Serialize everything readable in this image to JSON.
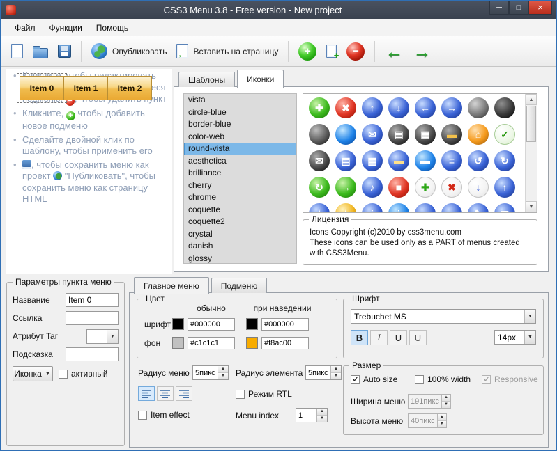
{
  "window": {
    "title": "CSS3 Menu 3.8 - Free version - New project",
    "controls": {
      "minimize": "─",
      "maximize": "□",
      "close": "×"
    }
  },
  "menubar": {
    "items": [
      {
        "label": "Файл"
      },
      {
        "label": "Функции"
      },
      {
        "label": "Помощь"
      }
    ]
  },
  "toolbar": {
    "publish_label": "Опубликовать",
    "insert_label": "Вставить на страницу",
    "plus_glyph": "+",
    "minus_glyph": "−",
    "arrow_left_glyph": "←",
    "arrow_right_glyph": "→"
  },
  "preview": {
    "items": [
      "Item 0",
      "Item 1",
      "Item 2"
    ]
  },
  "instructions": {
    "bullet1_pre": "Кликните, чтобы редактировать параметры пункта и появившееся подменю, ",
    "bullet1_post": ", чтобы удалить пункт",
    "bullet2_pre": "Кликните, ",
    "bullet2_post": " чтобы добавить новое подменю",
    "bullet3": "Сделайте двойной клик по шаблону, чтобы применить его",
    "bullet4_mid": ", чтобы сохранить меню как проект ",
    "bullet4_post": " \"Публиковать\", чтобы сохранить меню как страницу HTML"
  },
  "top_tabs": {
    "templates_label": "Шаблоны",
    "icons_label": "Иконки"
  },
  "templates": {
    "items": [
      "vista",
      "circle-blue",
      "border-blue",
      "color-web",
      "round-vista",
      "aesthetica",
      "brilliance",
      "cherry",
      "chrome",
      "coquette",
      "coquette2",
      "crystal",
      "danish",
      "glossy"
    ],
    "selected": "round-vista"
  },
  "icons": {
    "palettes": {
      "blue": [
        "#c8dcff",
        "#3a63d6",
        "#162e7c"
      ],
      "dark": [
        "#ababab",
        "#4a4a4a",
        "#050505"
      ],
      "green": [
        "#c8f2a8",
        "#3dbb1e",
        "#156d04"
      ],
      "red": [
        "#ffb4a8",
        "#e03524",
        "#8c0e00"
      ],
      "gray1": [
        "#d4d4d4",
        "#7a7a7a",
        "#2a2a2a"
      ],
      "gray2": [
        "#8f8f8f",
        "#383838",
        "#000000"
      ],
      "gray3": [
        "#bdbdbd",
        "#5c5c5c",
        "#101010"
      ],
      "skyblue": [
        "#c2e6ff",
        "#1f83e8",
        "#083e8c"
      ],
      "orange": [
        "#ffe0b0",
        "#f59a1c",
        "#94560a"
      ],
      "check": [
        "#ffffff",
        "#eef8e8",
        "#d8eec8"
      ],
      "light": [
        "#ffffff",
        "#f4f4f4",
        "#e0e0e0"
      ],
      "gold": [
        "#fff2bc",
        "#f0b41e",
        "#8f6400"
      ]
    },
    "grid": [
      {
        "name": "icon-add-circle",
        "glyph": "✚",
        "palette": "green"
      },
      {
        "name": "icon-delete-circle",
        "glyph": "✖",
        "palette": "red"
      },
      {
        "name": "icon-arrow-up-circle",
        "glyph": "↑",
        "palette": "blue"
      },
      {
        "name": "icon-arrow-down-circle",
        "glyph": "↓",
        "palette": "blue"
      },
      {
        "name": "icon-arrow-left-circle",
        "glyph": "←",
        "palette": "blue"
      },
      {
        "name": "icon-arrow-right-circle",
        "glyph": "→",
        "palette": "blue"
      },
      {
        "name": "icon-sphere-gray",
        "glyph": "",
        "palette": "gray1"
      },
      {
        "name": "icon-sphere-black",
        "glyph": "",
        "palette": "gray2"
      },
      {
        "name": "icon-sphere-dark",
        "glyph": "",
        "palette": "gray3"
      },
      {
        "name": "icon-sphere-blue",
        "glyph": "",
        "palette": "skyblue"
      },
      {
        "name": "icon-mail-blue-circle",
        "glyph": "✉",
        "palette": "blue"
      },
      {
        "name": "icon-print-dark-circle",
        "glyph": "▤",
        "palette": "dark"
      },
      {
        "name": "icon-save-dark-circle",
        "glyph": "▦",
        "palette": "dark"
      },
      {
        "name": "icon-folder-dark-circle",
        "glyph": "▬",
        "palette": "dark",
        "fg": "#f3c14b"
      },
      {
        "name": "icon-home-orange-circle",
        "glyph": "⌂",
        "palette": "orange"
      },
      {
        "name": "icon-check-circle",
        "glyph": "✓",
        "palette": "check",
        "fg": "#2a9a12",
        "border": "#a8cc98"
      },
      {
        "name": "icon-mail-dark-circle",
        "glyph": "✉",
        "palette": "dark"
      },
      {
        "name": "icon-print-blue-circle",
        "glyph": "▤",
        "palette": "blue"
      },
      {
        "name": "icon-save-blue-circle",
        "glyph": "▦",
        "palette": "blue"
      },
      {
        "name": "icon-folder-blue-circle",
        "glyph": "▬",
        "palette": "blue",
        "fg": "#ffe08a"
      },
      {
        "name": "icon-folder-open-circle",
        "glyph": "▬",
        "palette": "skyblue"
      },
      {
        "name": "icon-document-circle",
        "glyph": "≡",
        "palette": "blue"
      },
      {
        "name": "icon-undo-circle",
        "glyph": "↺",
        "palette": "blue"
      },
      {
        "name": "icon-redo-circle",
        "glyph": "↻",
        "palette": "blue"
      },
      {
        "name": "icon-refresh-green-circle",
        "glyph": "↻",
        "palette": "green"
      },
      {
        "name": "icon-go-green-circle",
        "glyph": "→",
        "palette": "green"
      },
      {
        "name": "icon-sound-circle",
        "glyph": "♪",
        "palette": "blue"
      },
      {
        "name": "icon-stop-circle",
        "glyph": "■",
        "palette": "red"
      },
      {
        "name": "icon-add-light",
        "glyph": "✚",
        "palette": "light",
        "fg": "#2fa818",
        "border": "#c4c4c4"
      },
      {
        "name": "icon-remove-light",
        "glyph": "✖",
        "palette": "light",
        "fg": "#d22816",
        "border": "#c4c4c4"
      },
      {
        "name": "icon-down-light",
        "glyph": "↓",
        "palette": "light",
        "fg": "#2f55d4",
        "border": "#c4c4c4"
      },
      {
        "name": "icon-up-blue-circle",
        "glyph": "↑",
        "palette": "blue"
      },
      {
        "name": "icon-star-blue-circle",
        "glyph": "★",
        "palette": "blue"
      },
      {
        "name": "icon-star-gold-circle",
        "glyph": "★",
        "palette": "gold"
      },
      {
        "name": "icon-info-circle",
        "glyph": "i",
        "palette": "blue"
      },
      {
        "name": "icon-info-circle2",
        "glyph": "i",
        "palette": "skyblue"
      },
      {
        "name": "icon-doc-circle2",
        "glyph": "≡",
        "palette": "blue"
      },
      {
        "name": "icon-doc-circle3",
        "glyph": "≡",
        "palette": "blue"
      },
      {
        "name": "icon-pencil-circle",
        "glyph": "✎",
        "palette": "blue"
      },
      {
        "name": "icon-mail-circle2",
        "glyph": "✉",
        "palette": "blue"
      }
    ]
  },
  "license": {
    "title": "Лицензия",
    "line1": "Icons Copyright (c)2010 by css3menu.com",
    "line2": "These icons can be used only as a PART of menus created with CSS3Menu."
  },
  "params": {
    "title": "Параметры пункта меню",
    "name_label": "Название",
    "name_value": "Item 0",
    "link_label": "Ссылка",
    "link_value": "",
    "target_label": "Атрибут Tar",
    "hint_label": "Подсказка",
    "hint_value": "",
    "icon_button_label": "Иконка",
    "icon_button_arrow": "▼",
    "active_label": "активный"
  },
  "main_tabs": {
    "main_label": "Главное меню",
    "sub_label": "Подменю"
  },
  "color_group": {
    "title": "Цвет",
    "col_normal": "обычно",
    "col_hover": "при наведении",
    "font_row_label": "шрифт",
    "bg_row_label": "фон",
    "font_normal": "#000000",
    "font_hover": "#000000",
    "bg_normal": "#c1c1c1",
    "bg_hover": "#f8ac00"
  },
  "radius": {
    "menu_label": "Радиус меню",
    "menu_value": "5пикс",
    "element_label": "Радиус элемента",
    "element_value": "5пикс"
  },
  "options": {
    "rtl_label": "Режим RTL",
    "item_effect_label": "Item effect",
    "menu_index_label": "Menu index",
    "menu_index_value": "1"
  },
  "font_group": {
    "title": "Шрифт",
    "family": "Trebuchet MS",
    "styles": [
      "B",
      "I",
      "U",
      "U"
    ],
    "size": "14px"
  },
  "size_group": {
    "title": "Размер",
    "auto_size": "Auto size",
    "full_width": "100% width",
    "responsive": "Responsive",
    "width_label": "Ширина меню",
    "width_value": "191пикс",
    "height_label": "Высота меню",
    "height_value": "40пикс"
  }
}
